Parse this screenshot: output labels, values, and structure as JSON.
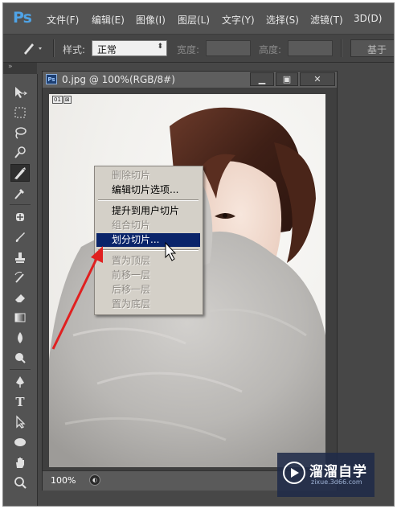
{
  "app": {
    "logo": "Ps",
    "menu": [
      "文件(F)",
      "编辑(E)",
      "图像(I)",
      "图层(L)",
      "文字(Y)",
      "选择(S)",
      "滤镜(T)",
      "3D(D)"
    ]
  },
  "options_bar": {
    "style_label": "样式:",
    "style_value": "正常",
    "width_label": "宽度:",
    "height_label": "高度:",
    "slices_button": "基于"
  },
  "toolbar": {
    "collapse": "»",
    "tools": [
      "move-tool",
      "marquee-tool",
      "lasso-tool",
      "quick-selection-tool",
      "slice-tool",
      "eyedropper-tool",
      "healing-brush-tool",
      "brush-tool",
      "clone-stamp-tool",
      "history-brush-tool",
      "eraser-tool",
      "gradient-tool",
      "blur-tool",
      "dodge-tool",
      "pen-tool",
      "type-tool",
      "path-selection-tool",
      "ellipse-tool",
      "hand-tool",
      "zoom-tool"
    ],
    "active_tool": "slice-tool"
  },
  "document": {
    "badge": "Ps",
    "title": "0.jpg @ 100%(RGB/8#)",
    "zoom": "100%",
    "slice_badge_1": "01",
    "slice_badge_2": "⊠"
  },
  "context_menu": {
    "items": [
      {
        "label": "删除切片",
        "enabled": false
      },
      {
        "label": "编辑切片选项...",
        "enabled": true
      },
      {
        "label": "提升到用户切片",
        "enabled": true
      },
      {
        "label": "组合切片",
        "enabled": false
      },
      {
        "label": "划分切片...",
        "enabled": true,
        "highlighted": true
      },
      {
        "label": "置为顶层",
        "enabled": false
      },
      {
        "label": "前移一层",
        "enabled": false
      },
      {
        "label": "后移一层",
        "enabled": false
      },
      {
        "label": "置为底层",
        "enabled": false
      }
    ]
  },
  "watermark": {
    "title": "溜溜自学",
    "url": "zixue.3d66.com"
  },
  "colors": {
    "ps_blue": "#4fa3e6",
    "menu_highlight": "#0a246a",
    "annotation_arrow": "#e02020"
  }
}
